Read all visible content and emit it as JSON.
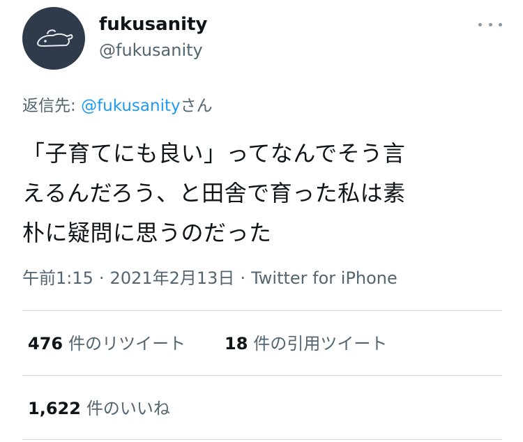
{
  "user": {
    "display_name": "fukusanity",
    "handle": "@fukusanity"
  },
  "icons": {
    "more": "more-horizontal-icon",
    "avatar": "cartoon-animal-avatar"
  },
  "reply": {
    "prefix": "返信先: ",
    "mention": "@fukusanity",
    "suffix": "さん"
  },
  "tweet": {
    "lines": [
      "「子育てにも良い」ってなんでそう言",
      "えるんだろう、と田舎で育った私は素",
      "朴に疑問に思うのだった"
    ]
  },
  "meta": {
    "time": "午前1:15",
    "separator": "·",
    "date": "2021年2月13日",
    "source": "Twitter for iPhone"
  },
  "stats": {
    "retweets_count": "476",
    "retweets_label": "件のリツイート",
    "quotes_count": "18",
    "quotes_label": "件の引用ツイート",
    "likes_count": "1,622",
    "likes_label": "件のいいね"
  },
  "colors": {
    "link": "#1d9bf0",
    "secondary_text": "#536471",
    "primary_text": "#0f1419",
    "avatar_bg": "#2f3a4b",
    "divider": "#cfd9de"
  }
}
